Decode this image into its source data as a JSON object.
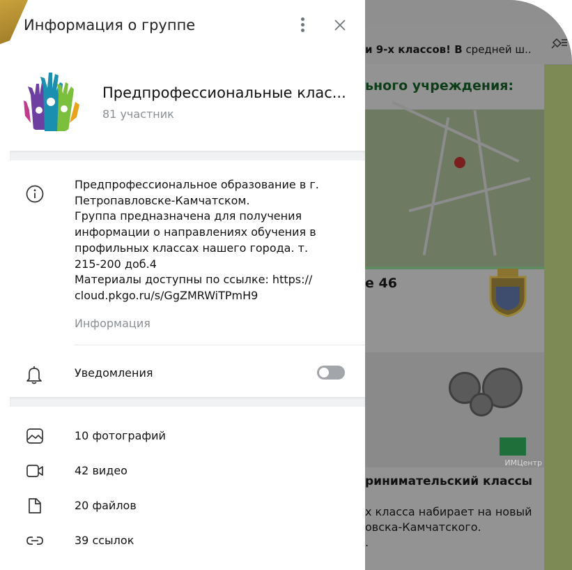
{
  "panel": {
    "title": "Информация о группе",
    "group_name": "Предпрофессиональные клас...",
    "members": "81 участник",
    "description_lines": [
      "Предпрофессиональное образование в г.",
      "Петропавловске-Камчатском.",
      "Группа предназначена для получения",
      "информации о направлениях обучения в",
      "профильных классах нашего города. т.",
      "215-200 доб.4",
      "Материалы доступны по ссылке: https://",
      "cloud.pkgo.ru/s/GgZMRWiTPmH9"
    ],
    "description_caption": "Информация",
    "notifications_label": "Уведомления",
    "notifications_on": false,
    "media": [
      {
        "icon": "photo-icon",
        "label": "10 фотографий"
      },
      {
        "icon": "video-icon",
        "label": "42 видео"
      },
      {
        "icon": "file-icon",
        "label": "20 файлов"
      },
      {
        "icon": "link-icon",
        "label": "39 ссылок"
      }
    ]
  },
  "chat": {
    "pinned_bold": "и 9-х классов! В",
    "pinned_rest": " средней ш...",
    "heading": "ьного учреждения:",
    "school_number": "e 46",
    "imc_label": "ИМЦентр",
    "class_title": "ринимательский классы",
    "class_body_lines": [
      "х класса набирает на новый",
      "овска-Камчатского.",
      "."
    ]
  },
  "colors": {
    "panel_bg": "#ffffff",
    "secondary_text": "#8a8f94",
    "divider": "#f1f2f4",
    "toggle_off": "#a2a5a9",
    "chat_dim": "#8f8f8f"
  }
}
